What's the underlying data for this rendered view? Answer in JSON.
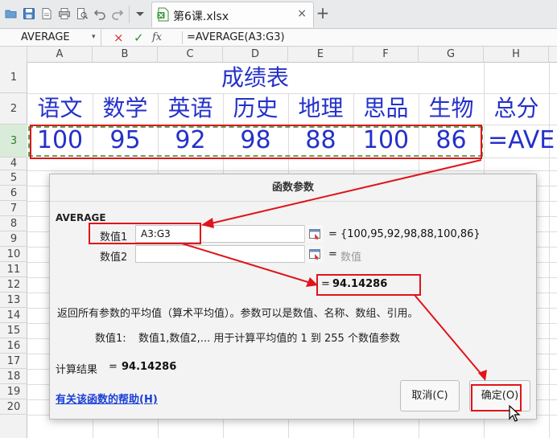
{
  "toolbar": {
    "icons": [
      "open-folder-icon",
      "save-icon",
      "export-icon",
      "print-icon",
      "print-preview-icon",
      "undo-icon",
      "redo-icon",
      "dropdown-icon"
    ]
  },
  "file_tab": {
    "label": "第6课.xlsx",
    "close": "×",
    "new_tab": "+"
  },
  "formula_bar": {
    "name_box": "AVERAGE",
    "name_box_arrow": "▾",
    "cancel": "×",
    "enter": "✓",
    "fx": "fx",
    "formula": "=AVERAGE(A3:G3)"
  },
  "grid": {
    "columns": [
      "A",
      "B",
      "C",
      "D",
      "E",
      "F",
      "G",
      "H"
    ],
    "rows": [
      "1",
      "2",
      "3",
      "4",
      "5",
      "6",
      "7",
      "8",
      "9",
      "10",
      "11",
      "12",
      "13",
      "14",
      "15",
      "16",
      "17",
      "18",
      "19",
      "20"
    ],
    "active_row": "3",
    "title": "成绩表",
    "headers": [
      "语文",
      "数学",
      "英语",
      "历史",
      "地理",
      "思品",
      "生物",
      "总分"
    ],
    "values": [
      "100",
      "95",
      "92",
      "98",
      "88",
      "100",
      "86"
    ],
    "h3_content": "=AVERAGE"
  },
  "dialog": {
    "title": "函数参数",
    "function_name": "AVERAGE",
    "arg1_label": "数值1",
    "arg1_value": "A3:G3",
    "arg1_result": "{100,95,92,98,88,100,86}",
    "arg2_label": "数值2",
    "arg2_value": "",
    "arg2_result": "数值",
    "eq": "=",
    "preview_result": "94.14286",
    "description": "返回所有参数的平均值（算术平均值）。参数可以是数值、名称、数组、引用。",
    "param_label": "数值1:",
    "param_description": "数值1,数值2,... 用于计算平均值的 1 到 255 个数值参数",
    "calc_label": "计算结果",
    "calc_value": "94.14286",
    "help_link": "有关该函数的帮助(H)",
    "cancel_button": "取消(C)",
    "ok_button": "确定(O)"
  },
  "colors": {
    "cell_text": "#2431c8",
    "annotation_red": "#e0141a",
    "marching_ants": "#5ba35b",
    "active_row_header": "#d9ecd9"
  }
}
